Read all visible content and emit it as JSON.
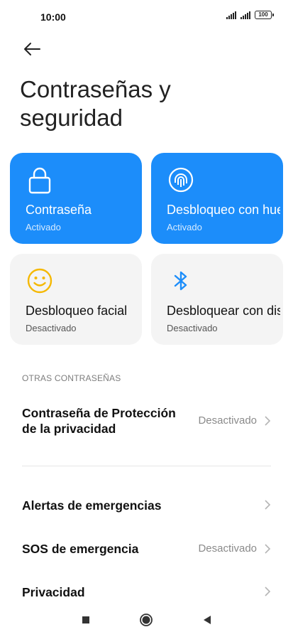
{
  "status_bar": {
    "time": "10:00",
    "battery": "100"
  },
  "header": {
    "title": "Contraseñas y seguridad"
  },
  "cards": [
    {
      "title": "Contraseña",
      "subtitle": "Activado",
      "icon": "lock-icon",
      "state": "on"
    },
    {
      "title": "Desbloqueo con huella",
      "subtitle": "Activado",
      "icon": "fingerprint-icon",
      "state": "on"
    },
    {
      "title": "Desbloqueo facial",
      "subtitle": "Desactivado",
      "icon": "face-icon",
      "state": "off"
    },
    {
      "title": "Desbloquear con dispositivo",
      "subtitle": "Desactivado",
      "icon": "bluetooth-icon",
      "state": "off"
    }
  ],
  "section": {
    "label": "OTRAS CONTRASEÑAS"
  },
  "rows": [
    {
      "label": "Contraseña de Protección de la privacidad",
      "value": "Desactivado"
    },
    {
      "label": "Alertas de emergencias",
      "value": ""
    },
    {
      "label": "SOS de emergencia",
      "value": "Desactivado"
    },
    {
      "label": "Privacidad",
      "value": ""
    }
  ],
  "colors": {
    "accent": "#1c8dfa",
    "face_icon": "#f5b800",
    "card_off_bg": "#f4f4f4"
  },
  "navbar": {
    "buttons": [
      "recents-icon",
      "home-icon",
      "back-icon"
    ]
  }
}
